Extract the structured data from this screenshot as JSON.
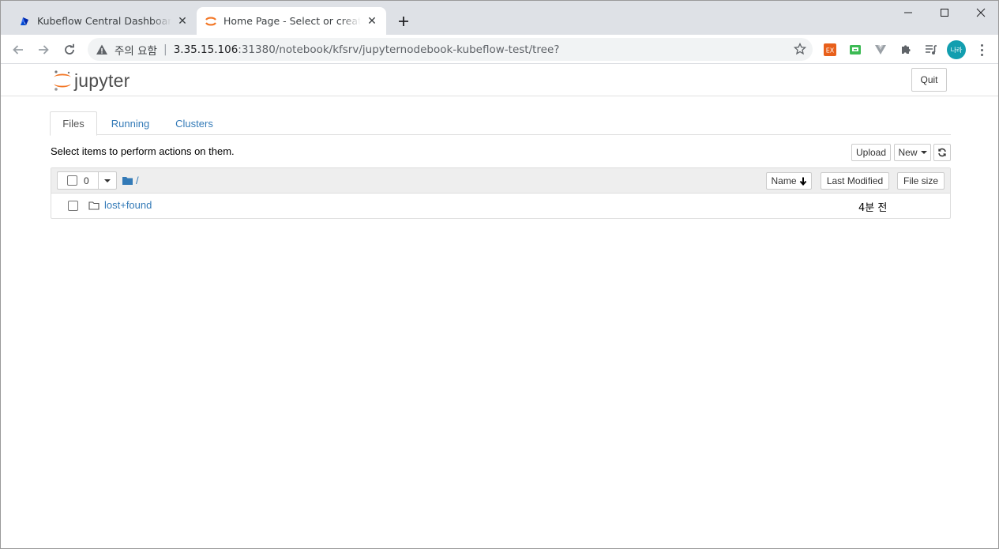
{
  "browser": {
    "tabs": [
      {
        "title": "Kubeflow Central Dashboard",
        "icon": "kubeflow-icon",
        "active": false
      },
      {
        "title": "Home Page - Select or create a notebook",
        "icon": "jupyter-icon",
        "active": true
      }
    ],
    "address": {
      "security_label": "주의 요함",
      "host": "3.35.15.106",
      "rest": ":31380/notebook/kfsrv/jupyternodebook-kubeflow-test/tree?"
    },
    "avatar_text": "나라",
    "extensions": [
      "ex-extension-icon",
      "green-extension-icon",
      "vue-extension-icon",
      "puzzle-extensions-icon",
      "media-queue-icon"
    ]
  },
  "jupyter": {
    "logo_text": "jupyter",
    "quit_label": "Quit",
    "tabs": [
      "Files",
      "Running",
      "Clusters"
    ],
    "hint": "Select items to perform actions on them.",
    "upload_label": "Upload",
    "new_label": "New",
    "selected_count": "0",
    "breadcrumb": "/",
    "columns": {
      "name": "Name",
      "modified": "Last Modified",
      "size": "File size"
    },
    "files": [
      {
        "name": "lost+found",
        "modified": "4분 전",
        "type": "folder"
      }
    ]
  },
  "colors": {
    "link": "#337ab7",
    "jupyter_orange": "#f37726",
    "avatar": "#129eaf"
  }
}
